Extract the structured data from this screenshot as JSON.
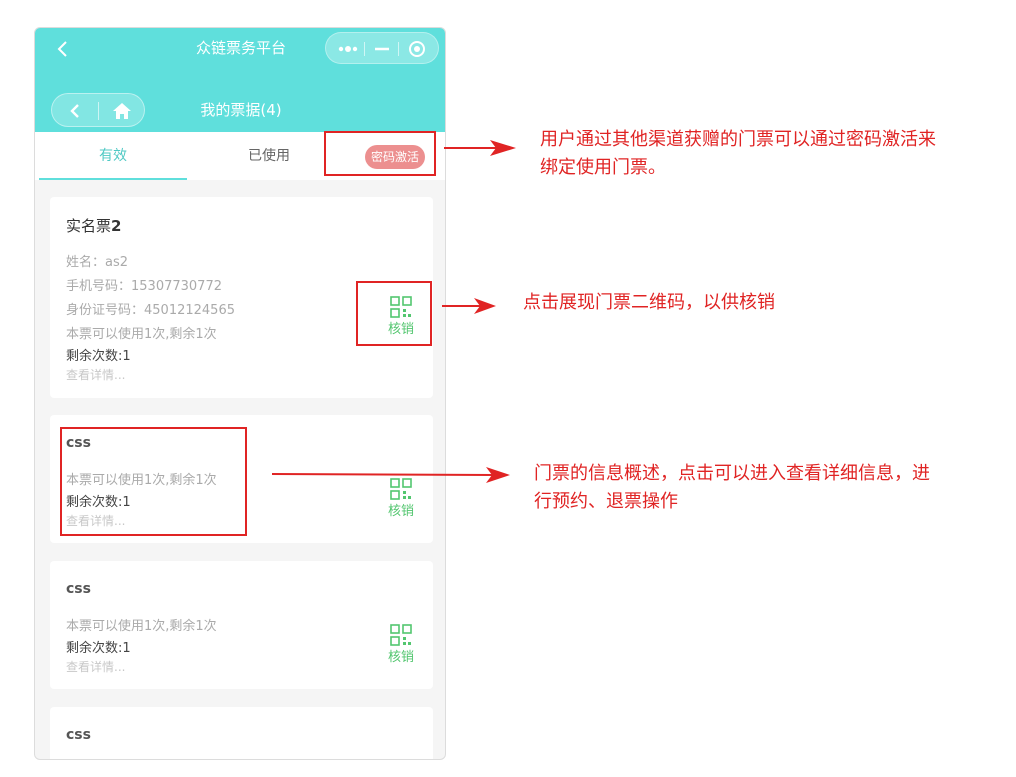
{
  "app": {
    "title": "众链票务平台",
    "page_title": "我的票据(4)"
  },
  "tabs": [
    {
      "label": "有效",
      "active": true
    },
    {
      "label": "已使用",
      "active": false
    }
  ],
  "activate_button": "密码激活",
  "tickets": [
    {
      "name": "实名票",
      "name_suffix": "2",
      "holder_name": "姓名：as2",
      "phone": "手机号码：15307730772",
      "id_number": "身份证号码：45012124565",
      "usage": "本票可以使用1次,剩余1次",
      "remaining": "剩余次数:1",
      "details_link": "查看详情...",
      "verify_label": "核销"
    },
    {
      "name": "css",
      "usage": "本票可以使用1次,剩余1次",
      "remaining": "剩余次数:1",
      "details_link": "查看详情...",
      "verify_label": "核销"
    },
    {
      "name": "css",
      "usage": "本票可以使用1次,剩余1次",
      "remaining": "剩余次数:1",
      "details_link": "查看详情...",
      "verify_label": "核销"
    },
    {
      "name": "css"
    }
  ],
  "annotations": {
    "activate_line1": "用户通过其他渠道获赠的门票可以通过密码激活来",
    "activate_line2": "绑定使用门票。",
    "qrcode": "点击展现门票二维码，以供核销",
    "info_line1": "门票的信息概述，点击可以进入查看详细信息，进",
    "info_line2": "行预约、退票操作"
  },
  "colors": {
    "header": "#5fdfdc",
    "activate": "#ec8f8f",
    "verify": "#53c66f",
    "annotation": "#e02424"
  },
  "icons": {
    "back": "chevron-left-icon",
    "more": "more-dots-icon",
    "minimize": "minus-icon",
    "close": "target-icon",
    "home": "home-icon",
    "verify": "qrcode-icon"
  }
}
